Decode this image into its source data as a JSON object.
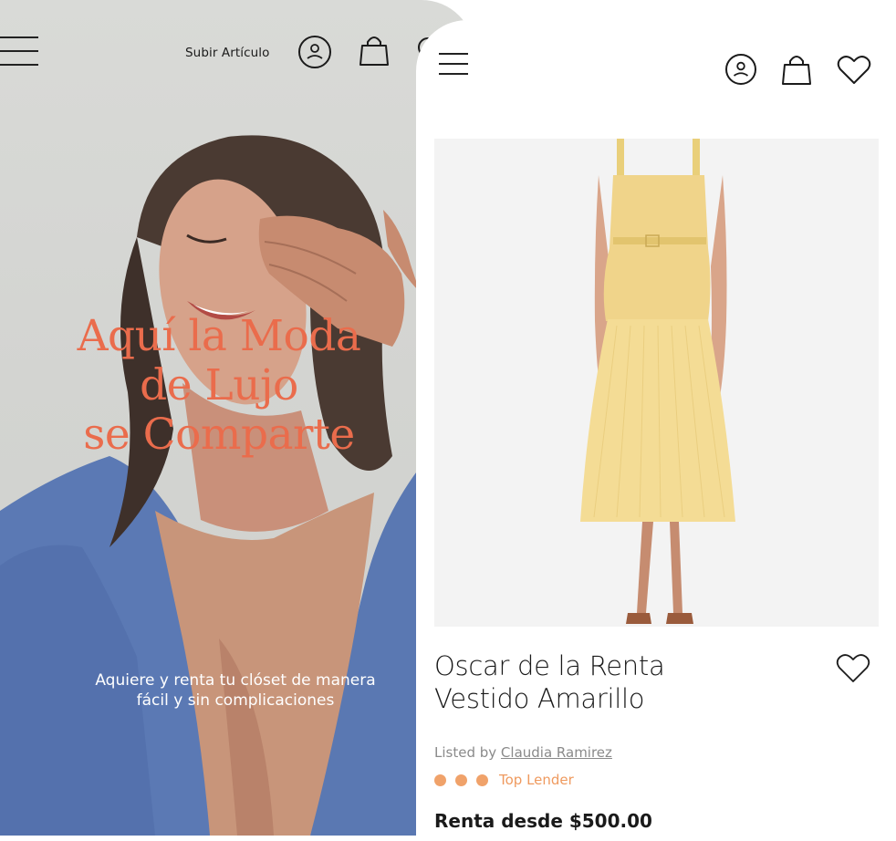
{
  "left_screen": {
    "upload_label": "Subir Artículo",
    "hero_title_lines": [
      "Aquí la Moda",
      "de Lujo",
      "se Comparte"
    ],
    "hero_subtitle_lines": [
      "Aquiere y renta tu clóset de manera",
      "fácil y sin complicaciones"
    ],
    "icons": [
      "menu-icon",
      "user-icon",
      "bag-icon",
      "search-icon"
    ]
  },
  "right_screen": {
    "icons": [
      "menu-icon",
      "user-icon",
      "bag-icon",
      "heart-icon"
    ],
    "product": {
      "brand": "Oscar de la Renta",
      "name": "Vestido Amarillo",
      "listed_by_prefix": "Listed by",
      "lister_name": "Claudia Ramirez",
      "rating_dots": 3,
      "badge": "Top Lender",
      "price": "Renta desde $500.00"
    }
  },
  "colors": {
    "hero_title": "#ea6c4c",
    "badge": "#ef9a5f",
    "dress": "#f2d88a"
  }
}
